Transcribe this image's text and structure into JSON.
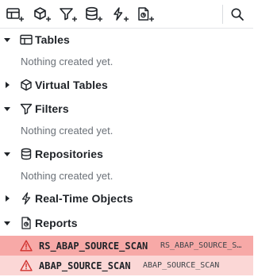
{
  "toolbar": {
    "buttons": [
      {
        "name": "add-table",
        "icon": "table-plus-icon"
      },
      {
        "name": "add-virtual-table",
        "icon": "cube-plus-icon"
      },
      {
        "name": "add-filter",
        "icon": "filter-plus-icon"
      },
      {
        "name": "add-repository",
        "icon": "database-plus-icon"
      },
      {
        "name": "add-realtime-object",
        "icon": "bolt-plus-icon"
      },
      {
        "name": "add-report",
        "icon": "report-plus-icon"
      }
    ],
    "search_icon": "search-icon"
  },
  "sections": {
    "tables": {
      "label": "Tables",
      "expanded": true,
      "empty_text": "Nothing created yet."
    },
    "virtual_tables": {
      "label": "Virtual Tables",
      "expanded": false
    },
    "filters": {
      "label": "Filters",
      "expanded": true,
      "empty_text": "Nothing created yet."
    },
    "repositories": {
      "label": "Repositories",
      "expanded": true,
      "empty_text": "Nothing created yet."
    },
    "realtime_objects": {
      "label": "Real-Time Objects",
      "expanded": false
    },
    "reports": {
      "label": "Reports",
      "expanded": true
    }
  },
  "reports": [
    {
      "name": "RS_ABAP_SOURCE_SCAN",
      "subtitle": "RS_ABAP_SOURCE_S…",
      "status": "warning"
    },
    {
      "name": "ABAP_SOURCE_SCAN",
      "subtitle": "ABAP_SOURCE_SCAN",
      "status": "warning"
    }
  ],
  "colors": {
    "report_selected_bg": "#f7a9a7",
    "report_bg": "#fbd7d6",
    "warning_icon": "#d0312d"
  }
}
